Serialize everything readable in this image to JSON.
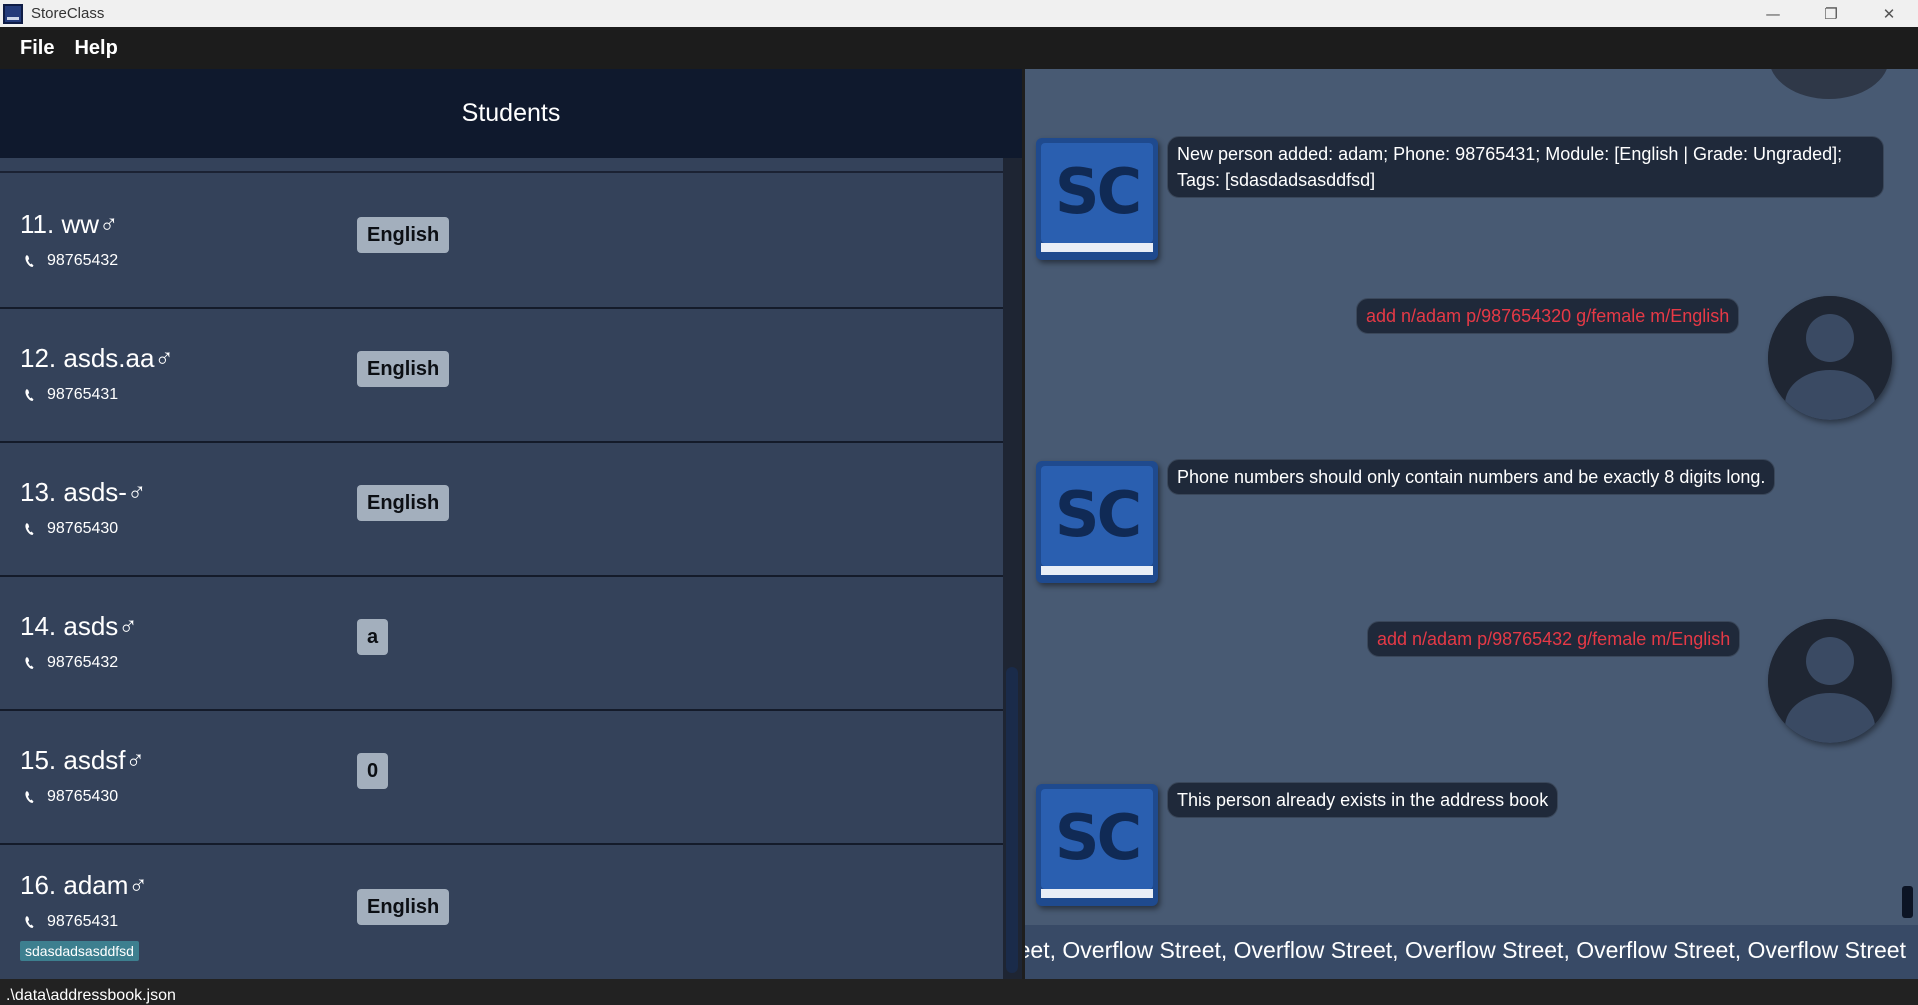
{
  "window": {
    "title": "StoreClass",
    "controls": {
      "minimize": "—",
      "restore": "❐",
      "close": "✕"
    }
  },
  "menu": {
    "file": "File",
    "help": "Help"
  },
  "students_panel": {
    "title": "Students",
    "cards": [
      {
        "name": "11. ww♂",
        "phone": "98765432",
        "module": "English",
        "tag": null
      },
      {
        "name": "12. asds.aa♂",
        "phone": "98765431",
        "module": "English",
        "tag": null
      },
      {
        "name": "13. asds-♂",
        "phone": "98765430",
        "module": "English",
        "tag": null
      },
      {
        "name": "14. asds♂",
        "phone": "98765432",
        "module": "a",
        "tag": null
      },
      {
        "name": "15. asdsf♂",
        "phone": "98765430",
        "module": "0",
        "tag": null
      },
      {
        "name": "16. adam♂",
        "phone": "98765431",
        "module": "English",
        "tag": "sdasdadsasddfsd"
      }
    ]
  },
  "chat": {
    "messages": [
      {
        "from": "bot",
        "logo": "SC",
        "text_line1": "New person added: adam; Phone: 98765431; Module: [English | Grade: Ungraded];",
        "text_line2": "Tags: [sdasdadsasddfsd]"
      },
      {
        "from": "user",
        "text": "add n/adam p/987654320 g/female m/English"
      },
      {
        "from": "bot",
        "logo": "SC",
        "text": "Phone numbers should only contain numbers and be exactly 8 digits long."
      },
      {
        "from": "user",
        "text": "add n/adam p/98765432 g/female m/English"
      },
      {
        "from": "bot",
        "logo": "SC",
        "text": "This person already exists in the address book"
      }
    ]
  },
  "command_box": {
    "value": "Street, Overflow Street, Overflow Street, Overflow Street, Overflow Street, Overflow Street"
  },
  "status_bar": {
    "path": ".\\data\\addressbook.json"
  },
  "colors": {
    "header_bg": "#0f192d",
    "card_bg": "#34425a",
    "chat_bg": "#485a73",
    "user_text": "#e63946",
    "tag_bg": "#3d7f8f",
    "module_bg": "#a3afbd"
  }
}
